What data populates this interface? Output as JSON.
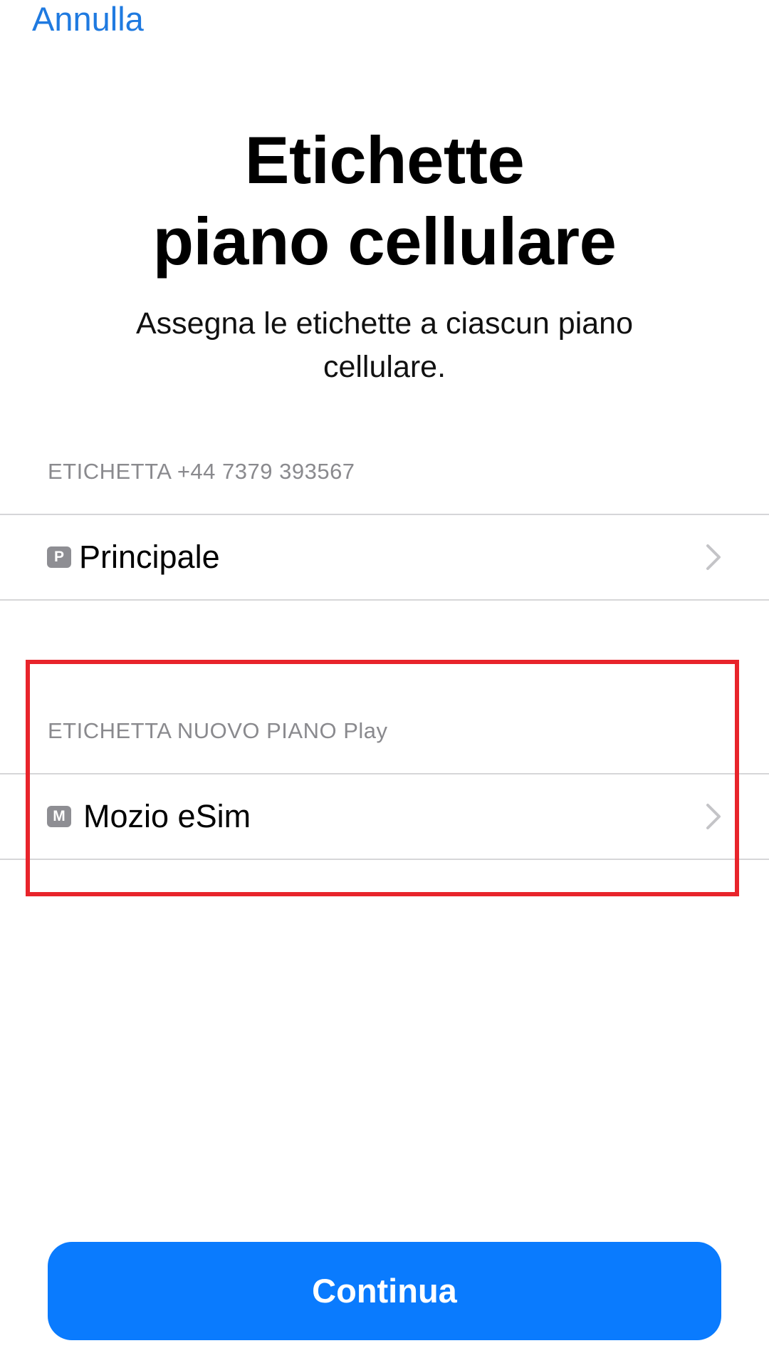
{
  "nav": {
    "cancel_label": "Annulla"
  },
  "header": {
    "title_line1": "Etichette",
    "title_line2": "piano cellulare",
    "subtitle": "Assegna le etichette a ciascun piano cellulare."
  },
  "sections": [
    {
      "header": "ETICHETTA +44 7379 393567",
      "row": {
        "badge": "P",
        "label": "Principale",
        "icon": "chevron-right-icon"
      }
    },
    {
      "header": "ETICHETTA NUOVO PIANO Play",
      "row": {
        "badge": "M",
        "label": "Mozio eSim",
        "icon": "chevron-right-icon"
      }
    }
  ],
  "footer": {
    "continue_label": "Continua"
  },
  "colors": {
    "accent": "#0a7bfe",
    "link": "#1f7ae0",
    "highlight": "#e8242b",
    "badge": "#8e8e93",
    "secondary_text": "#8a8a8e"
  }
}
